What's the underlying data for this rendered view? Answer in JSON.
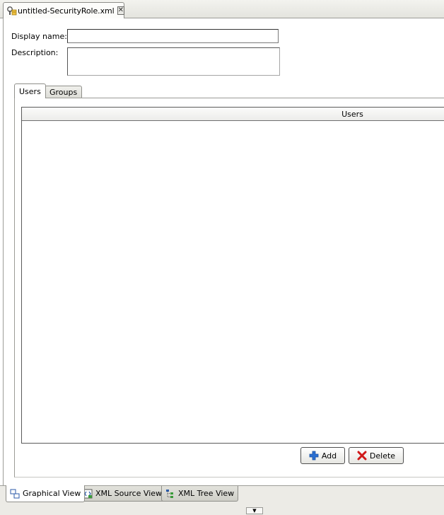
{
  "document_tab": {
    "title": "untitled-SecurityRole.xml",
    "icon": "xml-document-icon",
    "close_icon": "close-icon"
  },
  "form": {
    "display_name_label": "Display name:",
    "display_name_value": "",
    "description_label": "Description:",
    "description_value": ""
  },
  "sub_tabs": [
    {
      "label": "Users",
      "active": true
    },
    {
      "label": "Groups",
      "active": false
    }
  ],
  "users_table": {
    "columns": [
      "Users"
    ],
    "rows": []
  },
  "buttons": {
    "add_label": "Add",
    "delete_label": "Delete"
  },
  "view_tabs": [
    {
      "label": "Graphical View",
      "active": true,
      "icon": "graphical-view-icon"
    },
    {
      "label": "XML Source View",
      "active": false,
      "icon": "xml-source-icon"
    },
    {
      "label": "XML Tree View",
      "active": false,
      "icon": "xml-tree-icon"
    }
  ],
  "colors": {
    "add_icon": "#2a6fd1",
    "delete_icon": "#d01818"
  }
}
